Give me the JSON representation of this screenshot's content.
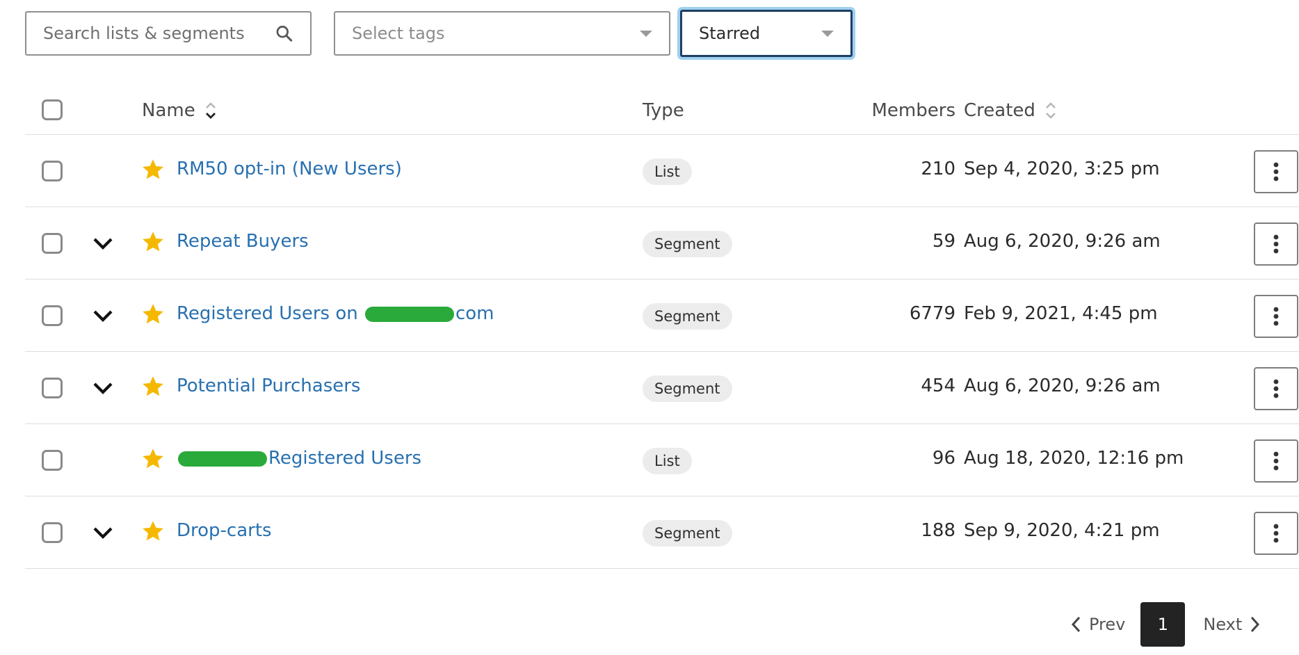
{
  "filters": {
    "search_placeholder": "Search lists & segments",
    "tags_placeholder": "Select tags",
    "view_selected": "Starred"
  },
  "table": {
    "headers": {
      "name": "Name",
      "type": "Type",
      "members": "Members",
      "created": "Created"
    },
    "rows": [
      {
        "name": "RM50 opt-in (New Users)",
        "type": "List",
        "members": "210",
        "created": "Sep 4, 2020, 3:25 pm",
        "expandable": false,
        "starred": true
      },
      {
        "name": "Repeat Buyers",
        "type": "Segment",
        "members": "59",
        "created": "Aug 6, 2020, 9:26 am",
        "expandable": true,
        "starred": true
      },
      {
        "name_before": "Registered Users on ",
        "name_after": "com",
        "type": "Segment",
        "members": "6779",
        "created": "Feb 9, 2021, 4:45 pm",
        "expandable": true,
        "starred": true,
        "redacted": true
      },
      {
        "name": "Potential Purchasers",
        "type": "Segment",
        "members": "454",
        "created": "Aug 6, 2020, 9:26 am",
        "expandable": true,
        "starred": true
      },
      {
        "name_before": "",
        "name_after": "Registered Users",
        "type": "List",
        "members": "96",
        "created": "Aug 18, 2020, 12:16 pm",
        "expandable": false,
        "starred": true,
        "redacted": true
      },
      {
        "name": "Drop-carts",
        "type": "Segment",
        "members": "188",
        "created": "Sep 9, 2020, 4:21 pm",
        "expandable": true,
        "starred": true
      }
    ]
  },
  "pagination": {
    "prev": "Prev",
    "current": "1",
    "next": "Next"
  },
  "colors": {
    "link": "#2870b0",
    "star": "#f5b800",
    "redaction": "#2aaa3a",
    "focus_ring": "#9fd0f0"
  },
  "icons": {
    "search": "search-icon",
    "star": "star-icon",
    "expand": "chevron-down-icon",
    "menu": "kebab-menu-icon",
    "sort": "sort-icon"
  }
}
